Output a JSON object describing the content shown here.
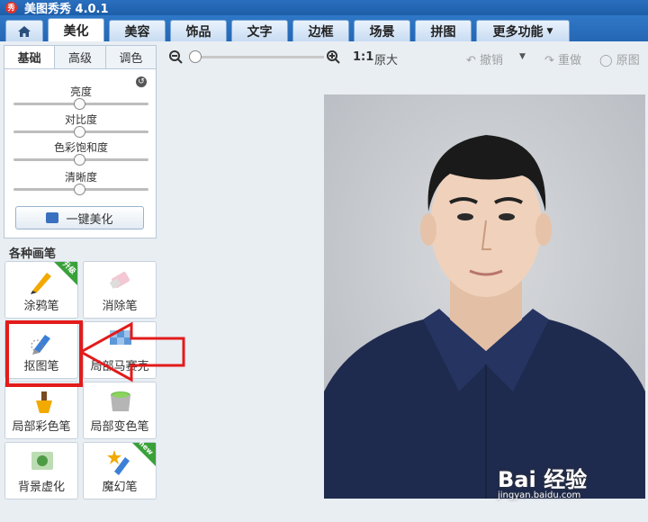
{
  "app": {
    "title": "美图秀秀 4.0.1",
    "logo_text": "秀"
  },
  "tabs": [
    {
      "label": "美化"
    },
    {
      "label": "美容"
    },
    {
      "label": "饰品"
    },
    {
      "label": "文字"
    },
    {
      "label": "边框"
    },
    {
      "label": "场景"
    },
    {
      "label": "拼图"
    },
    {
      "label": "更多功能"
    }
  ],
  "subtabs": [
    "基础",
    "高级",
    "调色"
  ],
  "sliders": [
    {
      "label": "亮度"
    },
    {
      "label": "对比度"
    },
    {
      "label": "色彩饱和度"
    },
    {
      "label": "清晰度"
    }
  ],
  "one_key": "一键美化",
  "brush_section_title": "各种画笔",
  "brushes": [
    {
      "label": "涂鸦笔",
      "badge": "升级"
    },
    {
      "label": "消除笔"
    },
    {
      "label": "抠图笔"
    },
    {
      "label": "局部马赛克"
    },
    {
      "label": "局部彩色笔"
    },
    {
      "label": "局部变色笔"
    },
    {
      "label": "背景虚化"
    },
    {
      "label": "魔幻笔",
      "badge": "new"
    }
  ],
  "toolbar": {
    "ratio": "1:1",
    "fullsize": "原大",
    "undo": "撤销",
    "redo": "重做",
    "origin": "原图"
  },
  "watermark": {
    "main": "Bai 经验",
    "sub": "jingyan.baidu.com"
  },
  "colors": {
    "tab_bar": "#2567b4",
    "highlight": "#e21b1b",
    "shirt": "#1f2b4e",
    "photo_bg": "#c9cbcf"
  }
}
